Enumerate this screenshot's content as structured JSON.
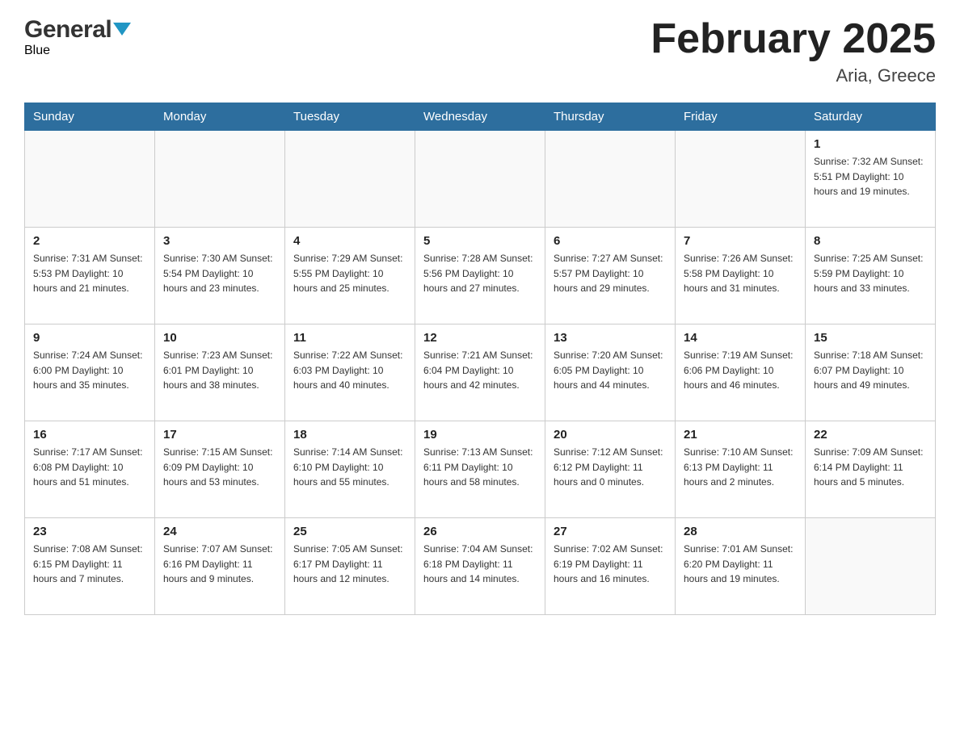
{
  "header": {
    "logo_general": "General",
    "logo_blue": "Blue",
    "title": "February 2025",
    "subtitle": "Aria, Greece"
  },
  "days_of_week": [
    "Sunday",
    "Monday",
    "Tuesday",
    "Wednesday",
    "Thursday",
    "Friday",
    "Saturday"
  ],
  "weeks": [
    [
      {
        "day": "",
        "info": ""
      },
      {
        "day": "",
        "info": ""
      },
      {
        "day": "",
        "info": ""
      },
      {
        "day": "",
        "info": ""
      },
      {
        "day": "",
        "info": ""
      },
      {
        "day": "",
        "info": ""
      },
      {
        "day": "1",
        "info": "Sunrise: 7:32 AM\nSunset: 5:51 PM\nDaylight: 10 hours and 19 minutes."
      }
    ],
    [
      {
        "day": "2",
        "info": "Sunrise: 7:31 AM\nSunset: 5:53 PM\nDaylight: 10 hours and 21 minutes."
      },
      {
        "day": "3",
        "info": "Sunrise: 7:30 AM\nSunset: 5:54 PM\nDaylight: 10 hours and 23 minutes."
      },
      {
        "day": "4",
        "info": "Sunrise: 7:29 AM\nSunset: 5:55 PM\nDaylight: 10 hours and 25 minutes."
      },
      {
        "day": "5",
        "info": "Sunrise: 7:28 AM\nSunset: 5:56 PM\nDaylight: 10 hours and 27 minutes."
      },
      {
        "day": "6",
        "info": "Sunrise: 7:27 AM\nSunset: 5:57 PM\nDaylight: 10 hours and 29 minutes."
      },
      {
        "day": "7",
        "info": "Sunrise: 7:26 AM\nSunset: 5:58 PM\nDaylight: 10 hours and 31 minutes."
      },
      {
        "day": "8",
        "info": "Sunrise: 7:25 AM\nSunset: 5:59 PM\nDaylight: 10 hours and 33 minutes."
      }
    ],
    [
      {
        "day": "9",
        "info": "Sunrise: 7:24 AM\nSunset: 6:00 PM\nDaylight: 10 hours and 35 minutes."
      },
      {
        "day": "10",
        "info": "Sunrise: 7:23 AM\nSunset: 6:01 PM\nDaylight: 10 hours and 38 minutes."
      },
      {
        "day": "11",
        "info": "Sunrise: 7:22 AM\nSunset: 6:03 PM\nDaylight: 10 hours and 40 minutes."
      },
      {
        "day": "12",
        "info": "Sunrise: 7:21 AM\nSunset: 6:04 PM\nDaylight: 10 hours and 42 minutes."
      },
      {
        "day": "13",
        "info": "Sunrise: 7:20 AM\nSunset: 6:05 PM\nDaylight: 10 hours and 44 minutes."
      },
      {
        "day": "14",
        "info": "Sunrise: 7:19 AM\nSunset: 6:06 PM\nDaylight: 10 hours and 46 minutes."
      },
      {
        "day": "15",
        "info": "Sunrise: 7:18 AM\nSunset: 6:07 PM\nDaylight: 10 hours and 49 minutes."
      }
    ],
    [
      {
        "day": "16",
        "info": "Sunrise: 7:17 AM\nSunset: 6:08 PM\nDaylight: 10 hours and 51 minutes."
      },
      {
        "day": "17",
        "info": "Sunrise: 7:15 AM\nSunset: 6:09 PM\nDaylight: 10 hours and 53 minutes."
      },
      {
        "day": "18",
        "info": "Sunrise: 7:14 AM\nSunset: 6:10 PM\nDaylight: 10 hours and 55 minutes."
      },
      {
        "day": "19",
        "info": "Sunrise: 7:13 AM\nSunset: 6:11 PM\nDaylight: 10 hours and 58 minutes."
      },
      {
        "day": "20",
        "info": "Sunrise: 7:12 AM\nSunset: 6:12 PM\nDaylight: 11 hours and 0 minutes."
      },
      {
        "day": "21",
        "info": "Sunrise: 7:10 AM\nSunset: 6:13 PM\nDaylight: 11 hours and 2 minutes."
      },
      {
        "day": "22",
        "info": "Sunrise: 7:09 AM\nSunset: 6:14 PM\nDaylight: 11 hours and 5 minutes."
      }
    ],
    [
      {
        "day": "23",
        "info": "Sunrise: 7:08 AM\nSunset: 6:15 PM\nDaylight: 11 hours and 7 minutes."
      },
      {
        "day": "24",
        "info": "Sunrise: 7:07 AM\nSunset: 6:16 PM\nDaylight: 11 hours and 9 minutes."
      },
      {
        "day": "25",
        "info": "Sunrise: 7:05 AM\nSunset: 6:17 PM\nDaylight: 11 hours and 12 minutes."
      },
      {
        "day": "26",
        "info": "Sunrise: 7:04 AM\nSunset: 6:18 PM\nDaylight: 11 hours and 14 minutes."
      },
      {
        "day": "27",
        "info": "Sunrise: 7:02 AM\nSunset: 6:19 PM\nDaylight: 11 hours and 16 minutes."
      },
      {
        "day": "28",
        "info": "Sunrise: 7:01 AM\nSunset: 6:20 PM\nDaylight: 11 hours and 19 minutes."
      },
      {
        "day": "",
        "info": ""
      }
    ]
  ]
}
